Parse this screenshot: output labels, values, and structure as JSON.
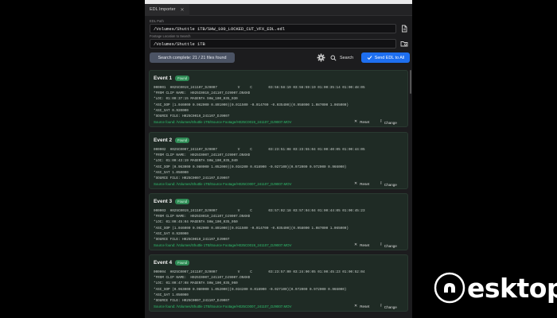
{
  "tab": {
    "label": "EDL Importer",
    "close": "✕"
  },
  "edl_path": {
    "label": "EDL Path",
    "value": "/Volumes/Shuttle 1TB/SHW_100_LOCKED_CUT_VFX_EDL.edl"
  },
  "footage": {
    "label": "Footage Location to Search",
    "value": "/Volumes/Shuttle 1TB"
  },
  "status": "Search complete: 21 / 21 files found",
  "toolbar": {
    "search_label": "Search",
    "send_label": "Send EDL to All"
  },
  "events": [
    {
      "title": "Event 1",
      "badge": "Found",
      "lines": [
        "000001  H025C0019_241107_DJ9007          V     C        03:56:58:19 03:56:59:19 01:00:35:14 01:00:48:05",
        "*FROM CLIP NAME:  H025C0019_241107_DJ9007.DNXHD",
        "*LOC: 01:00:37:15 MAGENTA SHW_100_035_030",
        "*ASC_SOP (1.046000 0.962000 0.891000)(0.011500 -0.014700 -0.035400)(0.958000 1.087000 1.065000)",
        "*ASC_SAT 0.920000",
        "*SOURCE FILE: H025C0019_241107_DJ9007"
      ],
      "found_text": "Source found: /Volumes/Shuttle 1TB/Source Footage/H025C0019_241107_DJ9007.MOV",
      "reset": "Reset",
      "change": "Change"
    },
    {
      "title": "Event 2",
      "badge": "Found",
      "lines": [
        "000002  H025C0007_241107_DJ9007          V     C        03:23:51:08 03:23:55:04 01:00:40:05 01:00:44:05",
        "*FROM CLIP NAME:  H025C0007_241107_DJ9007.DNXHD",
        "*LOC: 01:00:43:19 MAGENTA SHW_100_035_040",
        "*ASC_SOP (0.963000 0.980000 1.052000)(0.034200 0.018900 -0.027100)(0.972000 0.972000 0.966000)",
        "*ASC_SAT 1.050000",
        "*SOURCE FILE: H025C0007_241107_DJ9007"
      ],
      "found_text": "Source found: /Volumes/Shuttle 1TB/Source Footage/H025C0007_241107_DJ9007.MOV",
      "reset": "Reset",
      "change": "Change"
    },
    {
      "title": "Event 3",
      "badge": "Found",
      "lines": [
        "000003  H025C0019_241107_DJ9007          V     C        03:57:02:18 03:57:04:04 01:00:44:05 01:00:45:23",
        "*FROM CLIP NAME:  H025C0019_241107_DJ9007.DNXHD",
        "*LOC: 01:00:45:04 MAGENTA SHW_100_035_050",
        "*ASC_SOP (1.046000 0.962000 0.891000)(0.011500 -0.014700 -0.035400)(0.958000 1.087000 1.065000)",
        "*ASC_SAT 0.920000",
        "*SOURCE FILE: H025C0019_241107_DJ9007"
      ],
      "found_text": "Source found: /Volumes/Shuttle 1TB/Source Footage/H025C0019_241107_DJ9007.MOV",
      "reset": "Reset",
      "change": "Change"
    },
    {
      "title": "Event 4",
      "badge": "Found",
      "lines": [
        "000004  H025C0007_241107_DJ9007          V     C        03:23:57:00 03:24:00:05 01:00:45:23 01:00:52:04",
        "*FROM CLIP NAME:  H025C0007_241107_DJ9007.DNXHD",
        "*LOC: 01:00:47:08 MAGENTA SHW_100_035_060",
        "*ASC_SOP (0.963000 0.980000 1.052000)(0.034200 0.018900 -0.027100)(0.972000 0.972000 0.966000)",
        "*ASC_SAT 1.050000",
        "*SOURCE FILE: H025C0007_241107_DJ9007"
      ],
      "found_text": "Source found: /Volumes/Shuttle 1TB/Source Footage/H025C0007_241107_DJ9007.MOV",
      "reset": "Reset",
      "change": "Change"
    }
  ],
  "watermark": {
    "text": "4eskTop",
    "letter": "esktop"
  },
  "colors": {
    "accent": "#1e6ff0",
    "found": "#2fc06e",
    "badge_bg": "#2f8a55",
    "card_bg": "#1f2b25"
  }
}
